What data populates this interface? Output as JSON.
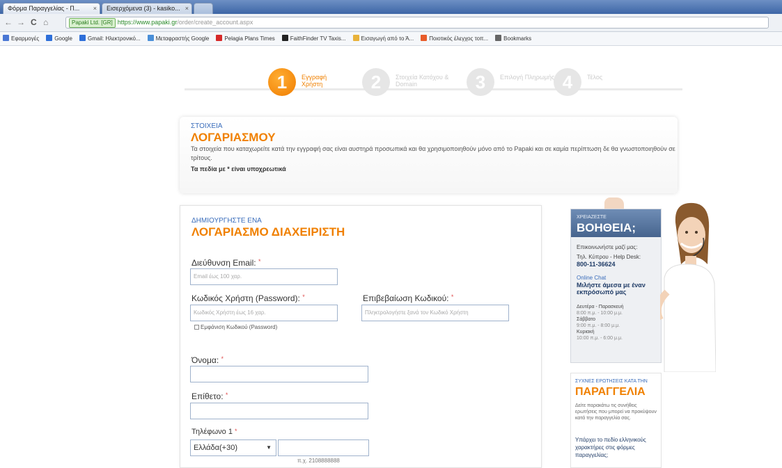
{
  "browser": {
    "tabs": [
      {
        "label": "Φόρμα Παραγγελίας - Π...",
        "close": "×"
      },
      {
        "label": "Εισερχόμενα (3) - kasiko...",
        "close": "×"
      }
    ],
    "nav": {
      "back": "←",
      "forward": "→",
      "reload": "C",
      "home": "⌂"
    },
    "ssl_badge": "Papaki Ltd. [GR]",
    "url_host": "https://www.papaki.gr",
    "url_path": "/order/create_account.aspx",
    "bookmarks": [
      {
        "label": "Εφαρμογές",
        "color": "#4a77d4"
      },
      {
        "label": "Google",
        "color": "#2e6fd9"
      },
      {
        "label": "Gmail: Ηλεκτρονικό...",
        "color": "#2e6fd9"
      },
      {
        "label": "Μεταφραστής Google",
        "color": "#4a8fd8"
      },
      {
        "label": "Pelagia Plans Times",
        "color": "#d62828"
      },
      {
        "label": "FaithFinder TV Taxis...",
        "color": "#222222"
      },
      {
        "label": "Εισαγωγή από το Ά...",
        "color": "#e8b23a"
      },
      {
        "label": "Ποιοτικός έλεγχος τοπ...",
        "color": "#e85c2a"
      },
      {
        "label": "Bookmarks",
        "color": "#666666"
      }
    ]
  },
  "steps": [
    {
      "num": "1",
      "label": "Εγγραφή Χρήστη",
      "active": true
    },
    {
      "num": "2",
      "label": "Στοιχεία Κατόχου & Domain",
      "active": false
    },
    {
      "num": "3",
      "label": "Επιλογή Πληρωμής",
      "active": false
    },
    {
      "num": "4",
      "label": "Τέλος",
      "active": false
    }
  ],
  "account_info": {
    "title_small": "ΣΤΟΙΧΕΙΑ",
    "title_big": "ΛΟΓΑΡΙΑΣΜΟΥ",
    "text": "Τα στοιχεία που καταχωρείτε κατά την εγγραφή σας είναι αυστηρά προσωπικά και θα χρησιμοποιηθούν μόνο από το Papaki και σε καμία περίπτωση δε θα γνωστοποιηθούν σε τρίτους.",
    "required_note": "Τα πεδία με * είναι υποχρεωτικά"
  },
  "form": {
    "title_small": "ΔΗΜΙΟΥΡΓΗΣΤΕ ΕΝΑ",
    "title_big": "ΛΟΓΑΡΙΑΣΜΟ ΔΙΑΧΕΙΡΙΣΤΗ",
    "email_label": "Διεύθυνση Email:",
    "email_placeholder": "Email έως 100 χαρ.",
    "password_label": "Κωδικός Χρήστη (Password):",
    "password_placeholder": "Κωδικός Χρήστη έως 16 χαρ.",
    "confirm_label": "Επιβεβαίωση Κωδικού:",
    "confirm_placeholder": "Πληκτρολογήστε ξανά τον Κωδικό Χρήστη",
    "show_password": "Εμφάνιση Κωδικού (Password)",
    "first_name_label": "Όνομα:",
    "last_name_label": "Επίθετο:",
    "phone_label": "Τηλέφωνο 1",
    "country_value": "Ελλάδα(+30)",
    "phone_hint": "π.χ. 2108888888",
    "star": "*"
  },
  "help": {
    "title_small": "ΧΡΕΙΑΖΕΣΤΕ",
    "title_big": "ΒΟΗΘΕΙΑ;",
    "contact": "Επικοινωνήστε μαζί μας:",
    "cyprus": "Τηλ. Κύπρου - Help Desk:",
    "phone": "800-11-36624",
    "chat_label": "Online Chat",
    "chat_text": "Μιλήστε άμεσα με έναν εκπρόσωπό μας",
    "hours_1": "Δευτέρα - Παρασκευή",
    "hours_2": "8:00 π.μ. - 10:00 μ.μ.",
    "hours_3": "Σάββατο",
    "hours_4": "9:00 π.μ. - 8:00 μ.μ.",
    "hours_5": "Κυριακή",
    "hours_6": "10:00 π.μ. - 6:00 μ.μ."
  },
  "faq": {
    "title_small": "ΣΥΧΝΕΣ ΕΡΩΤΗΣΕΙΣ ΚΑΤΑ ΤΗΝ",
    "title_big": "ΠΑΡΑΓΓΕΛΙΑ",
    "text": "Δείτε παρακάτω τις συνήθεις ερωτήσεις που μπορεί να προκύψουν κατά την παραγγελία σας.",
    "link": "Υπάρχει το πεδίο ελληνικούς χαρακτήρες στις φόρμες παραγγελίας;"
  }
}
